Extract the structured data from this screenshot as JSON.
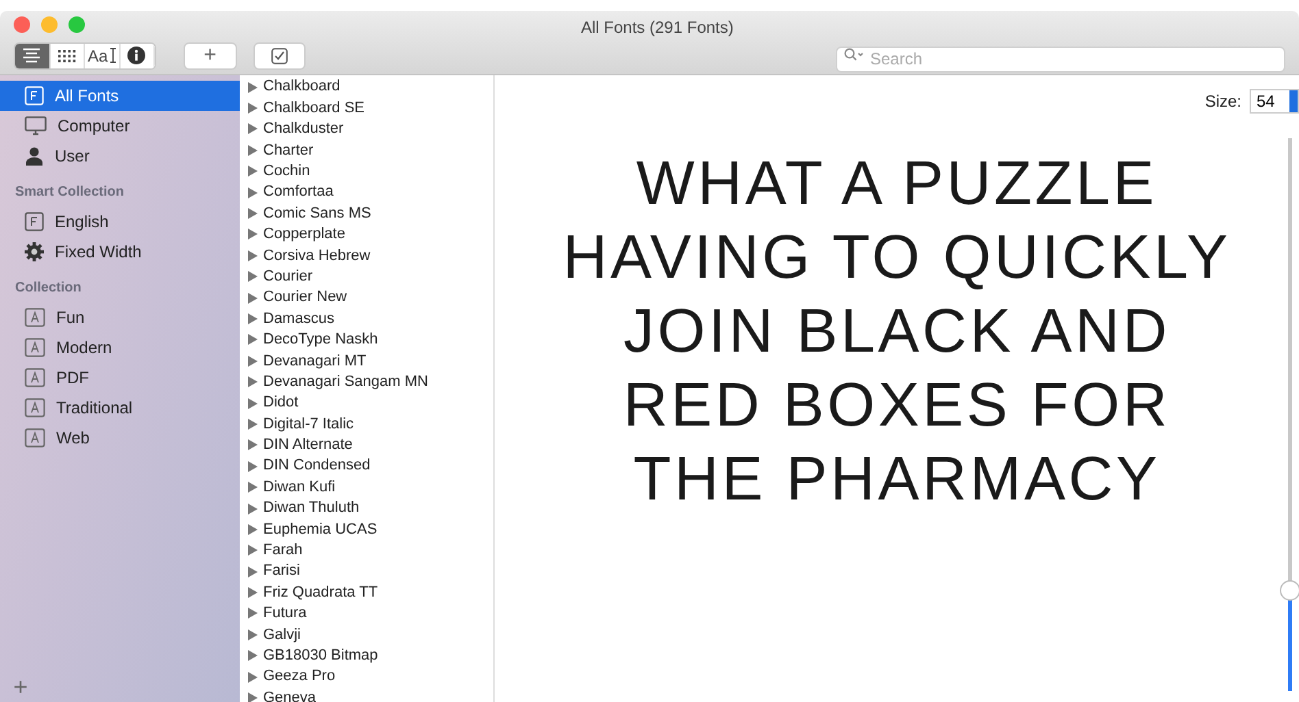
{
  "window": {
    "title": "All Fonts (291 Fonts)"
  },
  "toolbar": {
    "view_modes": [
      {
        "kind": "list",
        "selected": true
      },
      {
        "kind": "grid",
        "selected": false
      },
      {
        "kind": "sample",
        "label": "Aa",
        "selected": false
      },
      {
        "kind": "info",
        "selected": false
      }
    ],
    "add_button": "+",
    "search": {
      "placeholder": "Search"
    }
  },
  "sidebar": {
    "items": [
      {
        "label": "All Fonts",
        "kind": "font",
        "selected": true
      },
      {
        "label": "Computer",
        "kind": "monitor",
        "selected": false
      },
      {
        "label": "User",
        "kind": "person",
        "selected": false
      }
    ],
    "sections": [
      {
        "title": "Smart Collection",
        "items": [
          {
            "label": "English",
            "kind": "font",
            "selected": false
          },
          {
            "label": "Fixed Width",
            "kind": "gear",
            "selected": false
          }
        ]
      },
      {
        "title": "Collection",
        "items": [
          {
            "label": "Fun",
            "kind": "collection",
            "selected": false
          },
          {
            "label": "Modern",
            "kind": "collection",
            "selected": false
          },
          {
            "label": "PDF",
            "kind": "collection",
            "selected": false
          },
          {
            "label": "Traditional",
            "kind": "collection",
            "selected": false
          },
          {
            "label": "Web",
            "kind": "collection",
            "selected": false
          }
        ]
      }
    ],
    "add_button": "+"
  },
  "font_list": [
    "Chalkboard",
    "Chalkboard SE",
    "Chalkduster",
    "Charter",
    "Cochin",
    "Comfortaa",
    "Comic Sans MS",
    "Copperplate",
    "Corsiva Hebrew",
    "Courier",
    "Courier New",
    "Damascus",
    "DecoType Naskh",
    "Devanagari MT",
    "Devanagari Sangam MN",
    "Didot",
    "Digital-7 Italic",
    "DIN Alternate",
    "DIN Condensed",
    "Diwan Kufi",
    "Diwan Thuluth",
    "Euphemia UCAS",
    "Farah",
    "Farisi",
    "Friz Quadrata TT",
    "Futura",
    "Galvji",
    "GB18030 Bitmap",
    "Geeza Pro",
    "Geneva"
  ],
  "preview": {
    "size_label": "Size:",
    "size_value": "54",
    "size_slider": {
      "level": 0.18
    },
    "lines": [
      "WHAT A PUZZLE",
      "HAVING TO QUICKLY",
      "JOIN BLACK AND",
      "RED BOXES FOR",
      "THE PHARMACY"
    ]
  }
}
